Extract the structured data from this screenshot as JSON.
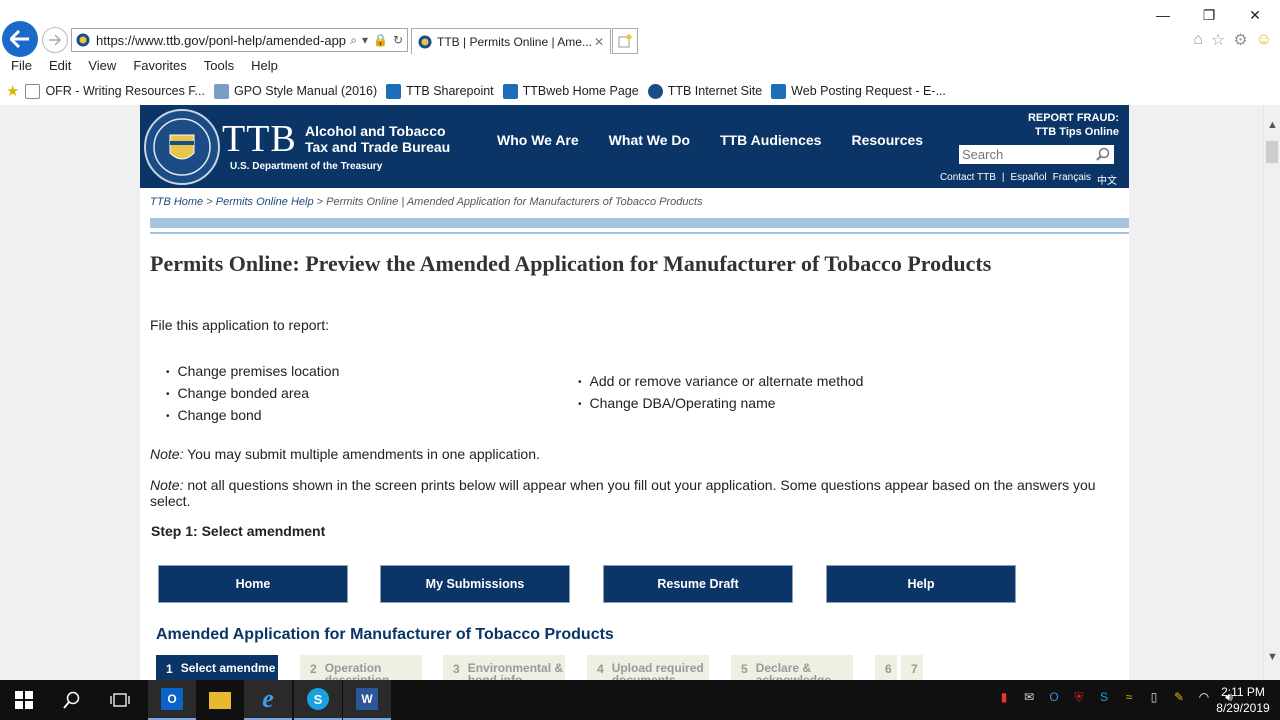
{
  "browser": {
    "url": "https://www.ttb.gov/ponl-help/amended-app",
    "tab_title": "TTB | Permits Online | Ame...",
    "window_controls": [
      "minimize",
      "restore",
      "close"
    ],
    "menu": [
      "File",
      "Edit",
      "View",
      "Favorites",
      "Tools",
      "Help"
    ],
    "favorites": [
      {
        "label": "OFR - Writing Resources F...",
        "icon": "page-icon"
      },
      {
        "label": "GPO Style Manual (2016)",
        "icon": "gpo-icon"
      },
      {
        "label": "TTB Sharepoint",
        "icon": "sharepoint-icon"
      },
      {
        "label": "TTBweb Home Page",
        "icon": "sharepoint-icon"
      },
      {
        "label": "TTB Internet Site",
        "icon": "ttb-seal-icon"
      },
      {
        "label": "Web Posting Request - E-...",
        "icon": "sharepoint-icon"
      }
    ]
  },
  "site": {
    "logo": "TTB",
    "agency_line1": "Alcohol and Tobacco",
    "agency_line2": "Tax and Trade Bureau",
    "dept": "U.S. Department of the Treasury",
    "nav": [
      "Who We Are",
      "What We Do",
      "TTB Audiences",
      "Resources"
    ],
    "report_line1": "REPORT FRAUD:",
    "report_line2": "TTB Tips Online",
    "search_placeholder": "Search",
    "links": [
      "Contact TTB",
      "|",
      "Español",
      "Français",
      "中文"
    ]
  },
  "breadcrumb": {
    "home": "TTB Home",
    "sep": ">",
    "help": "Permits Online Help",
    "current": "Permits Online | Amended Application for Manufacturers of Tobacco Products"
  },
  "main": {
    "title": "Permits Online: Preview the Amended Application for Manufacturer of Tobacco Products",
    "intro": "File this application to report:",
    "list_left": [
      "Change premises location",
      "Change bonded area",
      "Change bond"
    ],
    "list_right": [
      "Add or remove variance or alternate method",
      "Change DBA/Operating name"
    ],
    "note_label": "Note:",
    "note1": " You may submit multiple amendments in one application.",
    "note2": " not all questions shown in the screen prints below will appear when you fill out your application.  Some questions appear based on the answers you select.",
    "step1": "Step 1:  Select amendment",
    "buttons": [
      "Home",
      "My Submissions",
      "Resume Draft",
      "Help"
    ],
    "app_heading": "Amended Application for Manufacturer of Tobacco Products",
    "steps": [
      {
        "num": "1",
        "label": "Select amendme"
      },
      {
        "num": "2",
        "label": "Operation description"
      },
      {
        "num": "3",
        "label": "Environmental & bond info"
      },
      {
        "num": "4",
        "label": "Upload required documents"
      },
      {
        "num": "5",
        "label": "Declare & acknowledge"
      },
      {
        "num": "6",
        "label": ""
      },
      {
        "num": "7",
        "label": ""
      }
    ]
  },
  "taskbar": {
    "time": "2:11 PM",
    "date": "8/29/2019",
    "apps": [
      "outlook-icon",
      "file-explorer-icon",
      "internet-explorer-icon",
      "skype-icon",
      "word-icon"
    ]
  }
}
